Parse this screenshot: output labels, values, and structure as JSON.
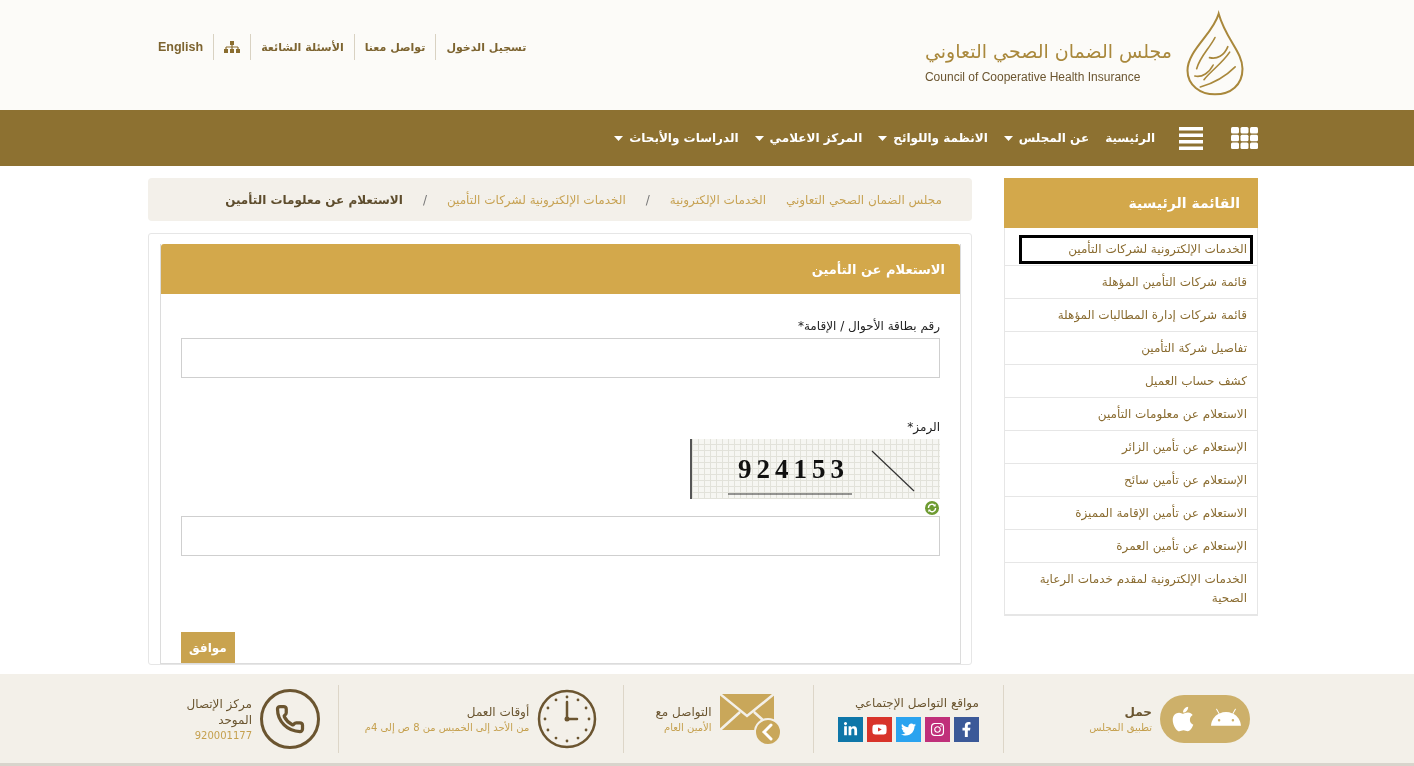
{
  "header": {
    "logo": {
      "name_ar": "مجلس الضمان الصحي التعاوني",
      "name_en": "Council of Cooperative Health Insurance"
    },
    "top_links": [
      {
        "kind": "link",
        "label": "تسجيل الدخول"
      },
      {
        "kind": "link",
        "label": "تواصل معنا"
      },
      {
        "kind": "link",
        "label": "الأسئلة الشائعة"
      },
      {
        "kind": "sitemap"
      },
      {
        "kind": "language",
        "label": "English"
      }
    ]
  },
  "nav": {
    "items": [
      {
        "label": "الرئيسية",
        "dropdown": false
      },
      {
        "label": "عن المجلس",
        "dropdown": true
      },
      {
        "label": "الانظمة واللوائح",
        "dropdown": true
      },
      {
        "label": "المركز الاعلامي",
        "dropdown": true
      },
      {
        "label": "الدراسات والأبحاث",
        "dropdown": true
      }
    ]
  },
  "sidebar": {
    "title": "القائمة الرئيسية",
    "items": [
      {
        "label": "الخدمات الإلكترونية لشركات التأمين",
        "focused": true
      },
      {
        "label": "قائمة شركات التأمين المؤهلة",
        "focused": false
      },
      {
        "label": "قائمة شركات إدارة المطالبات المؤهلة",
        "focused": false
      },
      {
        "label": "تفاصيل شركة التأمين",
        "focused": false
      },
      {
        "label": "كشف حساب العميل",
        "focused": false
      },
      {
        "label": "الاستعلام عن معلومات التأمين",
        "focused": false
      },
      {
        "label": "الإستعلام عن تأمين الزائر",
        "focused": false
      },
      {
        "label": "الإستعلام عن تأمين سائح",
        "focused": false
      },
      {
        "label": "الاستعلام عن تأمين الإقامة المميزة",
        "focused": false
      },
      {
        "label": "الإستعلام عن تأمين العمرة",
        "focused": false
      },
      {
        "label": "الخدمات الإلكترونية لمقدم خدمات الرعاية الصحية",
        "focused": false
      }
    ]
  },
  "breadcrumb": [
    {
      "label": "مجلس الضمان الصحي التعاوني",
      "current": false
    },
    {
      "label": "الخدمات الإلكترونية",
      "current": false
    },
    {
      "separator": "/",
      "label": "الخدمات الإلكترونية لشركات التأمين",
      "current": false
    },
    {
      "separator": "/",
      "label": "الاستعلام عن معلومات التأمين",
      "current": true
    }
  ],
  "form": {
    "title": "الاستعلام عن التأمين",
    "fields": [
      {
        "kind": "text",
        "label": "رقم بطاقة الأحوال / الإقامة*"
      },
      {
        "kind": "captcha",
        "label": "الرمز*",
        "code": "924153"
      }
    ],
    "submit": "موافق"
  },
  "footer": {
    "sections": [
      {
        "kind": "app",
        "title": "حمل",
        "subtitle": "تطبيق المجلس"
      },
      {
        "kind": "social",
        "title": "مواقع التواصل الإجتماعي"
      },
      {
        "kind": "mail",
        "title": "التواصل مع",
        "subtitle": "الأمين العام"
      },
      {
        "kind": "hours",
        "title": "أوقات العمل",
        "subtitle": "من الأحد إلى الخميس من 8 ص إلى 4م"
      },
      {
        "kind": "phone",
        "title": "مركز الإتصال الموحد",
        "subtitle": "920001177"
      }
    ]
  }
}
